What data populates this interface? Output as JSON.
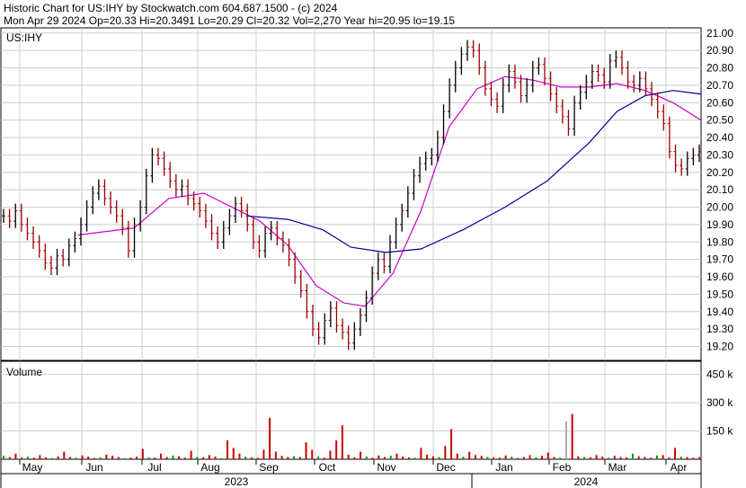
{
  "header": {
    "line1": "Historic Chart for US:IHY by Stockwatch.com 604.687.1500 - (c) 2024",
    "line2": "Mon Apr 29 2024   Op=20.33   Hi=20.3491   Lo=20.29   Cl=20.32   Vol=2,270   Year hi=20.95   lo=19.15"
  },
  "chart_data": {
    "type": "ohlc",
    "symbol_label": "US:IHY",
    "volume_label": "Volume",
    "price_ticks": [
      "21.00",
      "20.90",
      "20.80",
      "20.70",
      "20.60",
      "20.50",
      "20.40",
      "20.30",
      "20.20",
      "20.10",
      "20.00",
      "19.90",
      "19.80",
      "19.70",
      "19.60",
      "19.50",
      "19.40",
      "19.30",
      "19.20"
    ],
    "price_ylim": [
      19.12,
      21.03
    ],
    "volume_ticks": [
      "450 k",
      "300 k",
      "150 k"
    ],
    "volume_ylim": [
      0,
      520
    ],
    "months": [
      "May",
      "Jun",
      "Jul",
      "Aug",
      "Sep",
      "Oct",
      "Nov",
      "Dec",
      "Jan",
      "Feb",
      "Mar",
      "Apr"
    ],
    "years": [
      "2023",
      "2024"
    ],
    "series": [
      {
        "name": "",
        "color": "#cc00cc",
        "points": [
          [
            0.11,
            19.84
          ],
          [
            0.15,
            19.86
          ],
          [
            0.19,
            19.88
          ],
          [
            0.24,
            20.05
          ],
          [
            0.29,
            20.08
          ],
          [
            0.33,
            20.0
          ],
          [
            0.37,
            19.92
          ],
          [
            0.41,
            19.78
          ],
          [
            0.45,
            19.55
          ],
          [
            0.49,
            19.45
          ],
          [
            0.52,
            19.43
          ],
          [
            0.56,
            19.62
          ],
          [
            0.6,
            19.98
          ],
          [
            0.64,
            20.46
          ],
          [
            0.68,
            20.68
          ],
          [
            0.72,
            20.75
          ],
          [
            0.76,
            20.73
          ],
          [
            0.8,
            20.69
          ],
          [
            0.84,
            20.69
          ],
          [
            0.88,
            20.71
          ],
          [
            0.92,
            20.67
          ],
          [
            0.96,
            20.6
          ],
          [
            1.0,
            20.5
          ]
        ]
      },
      {
        "name": "",
        "color": "#000099",
        "points": [
          [
            0.35,
            19.95
          ],
          [
            0.41,
            19.93
          ],
          [
            0.46,
            19.87
          ],
          [
            0.5,
            19.77
          ],
          [
            0.55,
            19.74
          ],
          [
            0.6,
            19.76
          ],
          [
            0.66,
            19.87
          ],
          [
            0.72,
            20.0
          ],
          [
            0.78,
            20.15
          ],
          [
            0.84,
            20.37
          ],
          [
            0.88,
            20.55
          ],
          [
            0.92,
            20.64
          ],
          [
            0.96,
            20.67
          ],
          [
            1.0,
            20.65
          ]
        ]
      }
    ],
    "closes": [
      19.95,
      19.92,
      19.98,
      19.9,
      19.85,
      19.8,
      19.75,
      19.68,
      19.65,
      19.72,
      19.7,
      19.78,
      19.82,
      19.9,
      20.0,
      20.08,
      20.12,
      20.05,
      20.0,
      19.95,
      19.88,
      19.75,
      19.9,
      20.0,
      20.18,
      20.3,
      20.28,
      20.22,
      20.15,
      20.1,
      20.12,
      20.05,
      20.02,
      19.98,
      19.92,
      19.85,
      19.8,
      19.88,
      19.95,
      20.02,
      19.98,
      19.9,
      19.8,
      19.75,
      19.85,
      19.88,
      19.82,
      19.78,
      19.7,
      19.6,
      19.52,
      19.4,
      19.3,
      19.25,
      19.35,
      19.42,
      19.32,
      19.28,
      19.22,
      19.3,
      19.38,
      19.48,
      19.62,
      19.7,
      19.66,
      19.8,
      19.9,
      19.98,
      20.08,
      20.18,
      20.25,
      20.28,
      20.3,
      20.4,
      20.55,
      20.7,
      20.8,
      20.88,
      20.92,
      20.9,
      20.8,
      20.68,
      20.62,
      20.58,
      20.7,
      20.78,
      20.72,
      20.64,
      20.7,
      20.8,
      20.82,
      20.74,
      20.65,
      20.58,
      20.52,
      20.45,
      20.6,
      20.66,
      20.72,
      20.78,
      20.76,
      20.72,
      20.84,
      20.86,
      20.8,
      20.72,
      20.7,
      20.74,
      20.68,
      20.62,
      20.55,
      20.48,
      20.32,
      20.24,
      20.22,
      20.28,
      20.3,
      20.32
    ],
    "volumes": [
      18,
      12,
      30,
      9,
      14,
      8,
      22,
      10,
      6,
      15,
      40,
      12,
      8,
      20,
      14,
      6,
      10,
      25,
      18,
      12,
      6,
      9,
      14,
      55,
      10,
      8,
      30,
      12,
      20,
      16,
      8,
      45,
      12,
      10,
      22,
      14,
      6,
      100,
      60,
      30,
      14,
      10,
      8,
      50,
      220,
      40,
      18,
      12,
      16,
      12,
      90,
      50,
      14,
      8,
      45,
      100,
      180,
      24,
      10,
      40,
      14,
      8,
      20,
      12,
      18,
      30,
      14,
      10,
      8,
      60,
      24,
      16,
      12,
      70,
      160,
      30,
      14,
      40,
      22,
      18,
      12,
      10,
      8,
      20,
      14,
      6,
      12,
      22,
      10,
      18,
      36,
      12,
      8,
      200,
      240,
      16,
      12,
      10,
      22,
      14,
      8,
      18,
      12,
      10,
      30,
      16,
      12,
      8,
      20,
      22,
      10,
      60,
      14,
      12,
      8,
      10
    ]
  }
}
